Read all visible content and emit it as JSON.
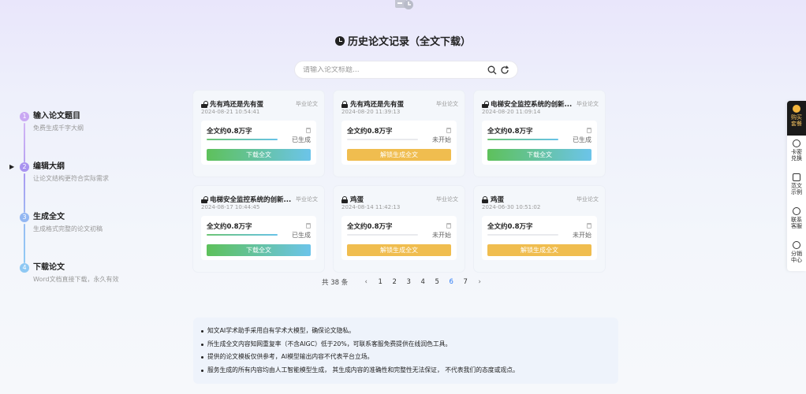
{
  "header": {
    "title": "历史论文记录（全文下载）"
  },
  "search": {
    "placeholder": "请输入论文标题..."
  },
  "steps": [
    {
      "num": "1",
      "title": "输入论文题目",
      "desc": "免费生成千字大纲",
      "color": "#c9a8f3"
    },
    {
      "num": "2",
      "title": "编辑大纲",
      "desc": "让论文结构更符合实际需求",
      "color": "#a993f0",
      "current": true
    },
    {
      "num": "3",
      "title": "生成全文",
      "desc": "生成格式完整的论文初稿",
      "color": "#93b7f2"
    },
    {
      "num": "4",
      "title": "下载论文",
      "desc": "Word文档直接下载，永久有效",
      "color": "#8ec8f3"
    }
  ],
  "cards": [
    {
      "title": "先有鸡还是先有蛋",
      "type": "毕业论文",
      "time": "2024-08-21 10:54:41",
      "word_count": "全文约0.8万字",
      "status": "已生成",
      "button": "下载全文",
      "state": "done",
      "locked": false
    },
    {
      "title": "先有鸡还是先有蛋",
      "type": "毕业论文",
      "time": "2024-08-20 11:39:13",
      "word_count": "全文约0.8万字",
      "status": "未开始",
      "button": "解锁生成全文",
      "state": "pending",
      "locked": true
    },
    {
      "title": "电梯安全监控系统的创新...",
      "type": "毕业论文",
      "time": "2024-08-20 11:09:14",
      "word_count": "全文约0.8万字",
      "status": "已生成",
      "button": "下载全文",
      "state": "done",
      "locked": false
    },
    {
      "title": "电梯安全监控系统的创新...",
      "type": "毕业论文",
      "time": "2024-08-17 10:44:45",
      "word_count": "全文约0.8万字",
      "status": "已生成",
      "button": "下载全文",
      "state": "done",
      "locked": false
    },
    {
      "title": "鸡蛋",
      "type": "毕业论文",
      "time": "2024-08-14 11:42:13",
      "word_count": "全文约0.8万字",
      "status": "未开始",
      "button": "解锁生成全文",
      "state": "pending",
      "locked": true
    },
    {
      "title": "鸡蛋",
      "type": "毕业论文",
      "time": "2024-06-30 10:51:02",
      "word_count": "全文约0.8万字",
      "status": "未开始",
      "button": "解锁生成全文",
      "state": "pending",
      "locked": true
    }
  ],
  "pagination": {
    "total": "共 38 条",
    "prev": "‹",
    "next": "›",
    "pages": [
      "1",
      "2",
      "3",
      "4",
      "5",
      "6",
      "7"
    ],
    "current": "6"
  },
  "notice": [
    "知文AI学术助手采用自有学术大模型，确保论文隐私。",
    "所生成全文内容知网重复率（不含AIGC）低于20%，可联系客服免费提供在线润色工具。",
    "提供的论文模板仅供参考，AI模型输出内容不代表平台立场。",
    "服务生成的所有内容均由人工智能模型生成，  其生成内容的准确性和完整性无法保证，  不代表我们的态度或观点。"
  ],
  "sidebar": [
    {
      "label": "购买套餐",
      "icon": "coin-icon"
    },
    {
      "label": "卡密兑换",
      "icon": "key-icon"
    },
    {
      "label": "范文示例",
      "icon": "document-icon"
    },
    {
      "label": "联系客服",
      "icon": "chat-icon"
    },
    {
      "label": "分销中心",
      "icon": "money-bag-icon"
    }
  ]
}
